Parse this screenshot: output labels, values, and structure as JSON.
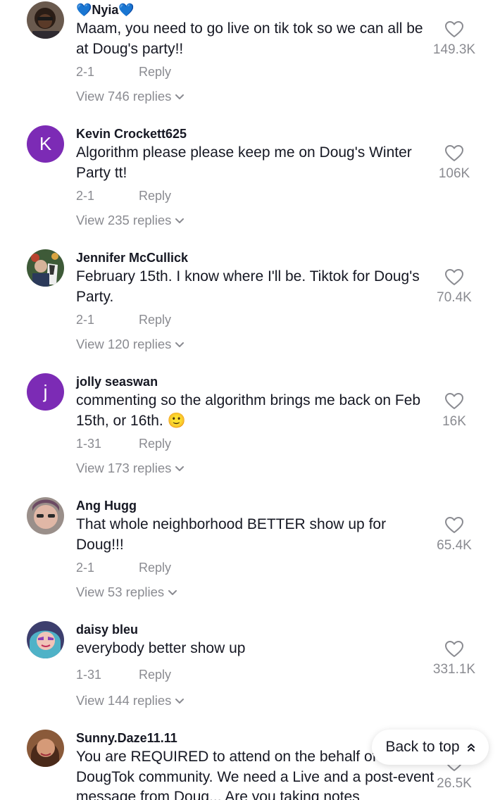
{
  "comments": [
    {
      "username": "💙Nyia💙",
      "text": "Maam, you need to go live on tik tok so we can all be at Doug's party!!",
      "date": "2-1",
      "reply": "Reply",
      "replies": "View 746 replies",
      "likes": "149.3K",
      "avatar": "photo"
    },
    {
      "username": "Kevin Crockett625",
      "text": "Algorithm please please keep me on Doug's Winter Party tt!",
      "date": "2-1",
      "reply": "Reply",
      "replies": "View 235 replies",
      "likes": "106K",
      "avatar": "K"
    },
    {
      "username": "Jennifer McCullick",
      "text": "February 15th. I know where I'll be. Tiktok for Doug's Party.",
      "date": "2-1",
      "reply": "Reply",
      "replies": "View 120 replies",
      "likes": "70.4K",
      "avatar": "photo"
    },
    {
      "username": "jolly seaswan",
      "text": "commenting so the algorithm brings me back on Feb 15th, or 16th. 🙂",
      "date": "1-31",
      "reply": "Reply",
      "replies": "View 173 replies",
      "likes": "16K",
      "avatar": "j"
    },
    {
      "username": "Ang Hugg",
      "text": "That whole neighborhood BETTER show up for Doug!!!",
      "date": "2-1",
      "reply": "Reply",
      "replies": "View 53 replies",
      "likes": "65.4K",
      "avatar": "photo"
    },
    {
      "username": "daisy bleu",
      "text": "everybody better show up",
      "date": "1-31",
      "reply": "Reply",
      "replies": "View 144 replies",
      "likes": "331.1K",
      "avatar": "photo"
    },
    {
      "username": "Sunny.Daze11.11",
      "text": "You are REQUIRED to attend on the behalf of DougTok community. We need a Live and a post-event message from Doug... Are you taking notes",
      "likes": "26.5K",
      "avatar": "photo"
    }
  ],
  "back_to_top": "Back to top",
  "colors": {
    "text": "#161823",
    "muted": "#8a8b91",
    "avatar_letter_bg": "#7c2bb5",
    "background": "#ffffff"
  },
  "icons": {
    "like": "heart-outline-icon",
    "expand": "chevron-down-icon",
    "back_to_top": "double-chevron-up-icon"
  }
}
